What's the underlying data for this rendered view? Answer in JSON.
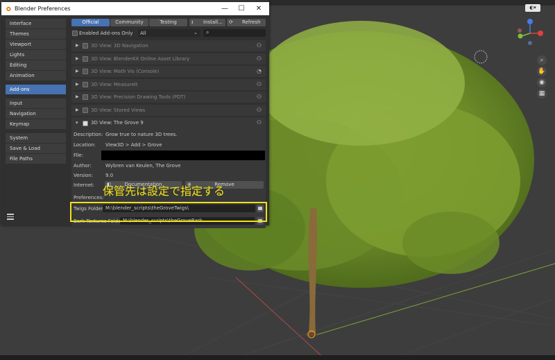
{
  "window": {
    "title": "Blender Preferences",
    "controls": {
      "minimize": "—",
      "maximize": "☐",
      "close": "✕"
    }
  },
  "sidebar": {
    "groups": [
      [
        "Interface",
        "Themes",
        "Viewport",
        "Lights",
        "Editing",
        "Animation"
      ],
      [
        "Add-ons"
      ],
      [
        "Input",
        "Navigation",
        "Keymap"
      ],
      [
        "System",
        "Save & Load",
        "File Paths"
      ]
    ],
    "active": "Add-ons"
  },
  "tabs": {
    "official": "Official",
    "community": "Community",
    "testing": "Testing",
    "install": "Install...",
    "refresh": "Refresh"
  },
  "filter": {
    "enabled_only": "Enabled Add-ons Only",
    "category": "All",
    "search_placeholder": ""
  },
  "addons": [
    {
      "name": "3D View: 3D Navigation",
      "icon": "user-icon"
    },
    {
      "name": "3D View: BlenderKit Online Asset Library",
      "icon": "user-icon"
    },
    {
      "name": "3D View: Math Vis (Console)",
      "icon": "blender-icon"
    },
    {
      "name": "3D View: MeasureIt",
      "icon": "user-icon"
    },
    {
      "name": "3D View: Precision Drawing Tools (PDT)",
      "icon": "user-icon"
    },
    {
      "name": "3D View: Stored Views",
      "icon": "user-icon"
    }
  ],
  "expanded_addon": {
    "name": "3D View: The Grove 9",
    "description_label": "Description:",
    "description": "Grow true to nature 3D trees.",
    "location_label": "Location:",
    "location": "View3D > Add > Grove",
    "file_label": "File:",
    "file": "",
    "author_label": "Author:",
    "author": "Wybren van Keulen, The Grove",
    "version_label": "Version:",
    "version": "9.0",
    "internet_label": "Internet:",
    "documentation": "Documentation",
    "remove": "Remove",
    "preferences_label": "Preferences:",
    "twigs_label": "Twigs Folder:",
    "twigs_path": "M:\\blender_scripts\\theGroveTwigs\\",
    "bark_label": "Bark Textures Folder:",
    "bark_path": "M:\\blender_scripts\\theGroveBark"
  },
  "annotation": "保管先は設定で指定する",
  "colors": {
    "accent": "#4772b3",
    "highlight": "#f0e21a",
    "annotation": "#f2e417"
  }
}
